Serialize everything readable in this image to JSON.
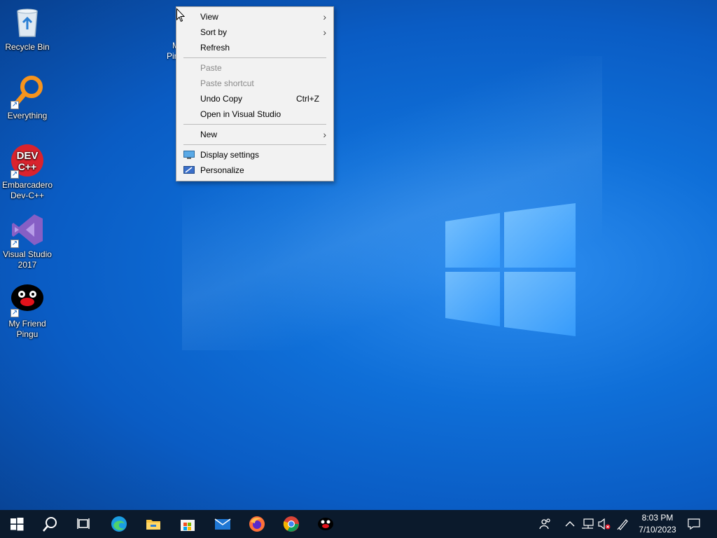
{
  "desktop_icons": [
    {
      "label": "Recycle Bin",
      "icon": "recycle-bin-icon"
    },
    {
      "label": "Everything",
      "icon": "everything-icon"
    },
    {
      "label": "Embarcadero Dev-C++",
      "icon": "devcpp-icon"
    },
    {
      "label": "Visual Studio 2017",
      "icon": "visual-studio-icon"
    },
    {
      "label": "My Friend Pingu",
      "icon": "pingu-icon"
    }
  ],
  "devcpp_logo_text": [
    "DEV",
    "C++"
  ],
  "hidden_icon_label_fragment": [
    "M",
    "Pin"
  ],
  "context_menu": {
    "view": "View",
    "sort_by": "Sort by",
    "refresh": "Refresh",
    "paste": "Paste",
    "paste_shortcut": "Paste shortcut",
    "undo_copy": "Undo Copy",
    "undo_copy_shortcut": "Ctrl+Z",
    "open_in_vs": "Open in Visual Studio",
    "new": "New",
    "display_settings": "Display settings",
    "personalize": "Personalize",
    "submenu_arrow": "›"
  },
  "taskbar": {
    "apps": [
      "start-icon",
      "search-icon",
      "task-view-icon",
      "edge-icon",
      "file-explorer-icon",
      "store-icon",
      "mail-icon",
      "firefox-icon",
      "chrome-icon",
      "pingu-icon"
    ],
    "clock_time": "8:03 PM",
    "clock_date": "7/10/2023"
  },
  "colors": {
    "desktop": "#0f6fd8",
    "taskbar": "#0b1a2c",
    "menu_bg": "#f2f2f2",
    "disabled_text": "#8a8a8a"
  }
}
